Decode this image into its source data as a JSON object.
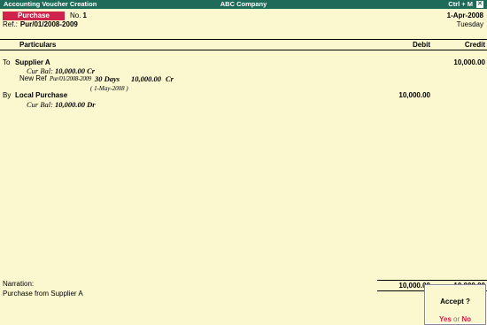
{
  "titlebar": {
    "left": "Accounting Voucher  Creation",
    "center": "ABC Company",
    "right": "Ctrl + M",
    "close_glyph": "✕"
  },
  "voucher": {
    "type": "Purchase",
    "no_label": "No.",
    "no_value": "1",
    "date": "1-Apr-2008",
    "day": "Tuesday",
    "ref_label": "Ref.:",
    "ref_value": "Pur/01/2008-2009"
  },
  "columns": {
    "particulars": "Particulars",
    "debit": "Debit",
    "credit": "Credit"
  },
  "entries": [
    {
      "prefix": "To",
      "ledger": "Supplier A",
      "cur_bal_label": "Cur Bal:",
      "cur_bal": "10,000.00 Cr",
      "credit": "10,000.00",
      "bill": {
        "type": "New Ref",
        "name": "Pur/01/2008-2009",
        "credit_period": "30 Days",
        "amount": "10,000.00",
        "dr_cr": "Cr",
        "due_date": "( 1-May-2008 )"
      }
    },
    {
      "prefix": "By",
      "ledger": "Local Purchase",
      "cur_bal_label": "Cur Bal:",
      "cur_bal": "10,000.00 Dr",
      "debit": "10,000.00"
    }
  ],
  "narration": {
    "label": "Narration:",
    "text": "Purchase from Supplier A"
  },
  "totals": {
    "debit": "10,000.00",
    "credit": "10,000.00"
  },
  "accept_dialog": {
    "question": "Accept ?",
    "yes": "Yes",
    "or": "or",
    "no": "No"
  },
  "colors": {
    "titlebar_bg": "#1f6b5a",
    "background": "#fbf7cf",
    "voucher_type_bg": "#d0234b",
    "yes_no": "#d0234b"
  }
}
